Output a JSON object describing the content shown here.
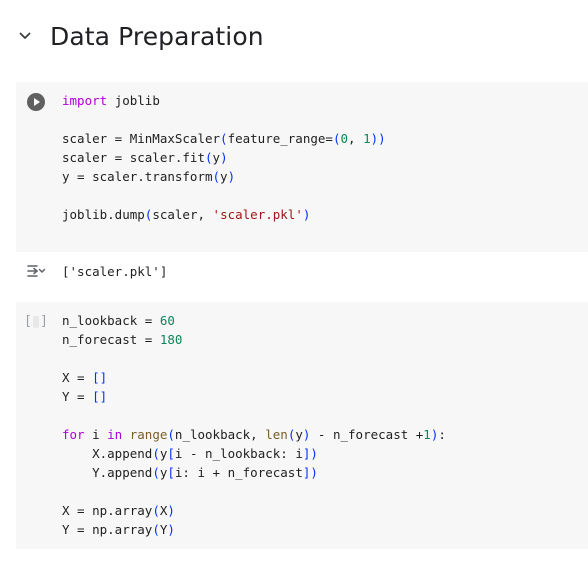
{
  "section": {
    "title": "Data Preparation",
    "collapse_icon": "chevron-down-icon"
  },
  "cell1": {
    "run_icon": "play-icon",
    "lines": [
      {
        "k": "import ",
        "t": "joblib"
      },
      {
        "t": ""
      },
      {
        "a": "scaler = MinMaxScaler",
        "p1": "(",
        "b": "feature_range=",
        "p2": "(",
        "n1": "0",
        "c": ", ",
        "n2": "1",
        "p3": "))"
      },
      {
        "a": "scaler = scaler.fit",
        "p1": "(",
        "b": "y",
        "p2": ")"
      },
      {
        "a": "y = scaler.transform",
        "p1": "(",
        "b": "y",
        "p2": ")"
      },
      {
        "t": ""
      },
      {
        "a": "joblib.dump",
        "p1": "(",
        "b": "scaler, ",
        "s": "'scaler.pkl'",
        "p2": ")"
      }
    ]
  },
  "output1": {
    "icon": "output-expand-icon",
    "text": "['scaler.pkl']"
  },
  "cell2": {
    "exec_open": "[",
    "exec_close": "]",
    "lines": [
      {
        "a": "n_lookback = ",
        "n": "60"
      },
      {
        "a": "n_forecast = ",
        "n": "180"
      },
      {
        "t": ""
      },
      {
        "a": "X = ",
        "br": "[]"
      },
      {
        "a": "Y = ",
        "br": "[]"
      },
      {
        "t": ""
      },
      {
        "k1": "for",
        "a": " i ",
        "k2": "in",
        "b": " ",
        "f1": "range",
        "p1": "(",
        "c": "n_lookback, ",
        "f2": "len",
        "p2": "(",
        "d": "y",
        "p3": ")",
        "e": " - n_forecast +",
        "n": "1",
        "p4": ")",
        "g": ":"
      },
      {
        "a": "    X.append",
        "p1": "(",
        "b": "y",
        "p2": "[",
        "c": "i - n_lookback: i",
        "p3": "])"
      },
      {
        "a": "    Y.append",
        "p1": "(",
        "b": "y",
        "p2": "[",
        "c": "i: i + n_forecast",
        "p3": "])"
      },
      {
        "t": ""
      },
      {
        "a": "X = np.array",
        "p1": "(",
        "b": "X",
        "p2": ")"
      },
      {
        "a": "Y = np.array",
        "p1": "(",
        "b": "Y",
        "p2": ")"
      }
    ]
  }
}
